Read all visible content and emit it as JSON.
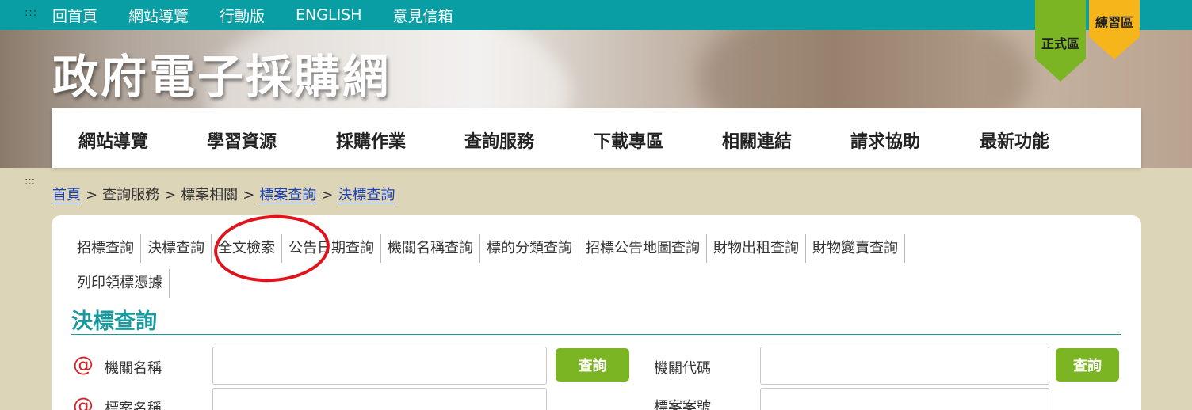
{
  "topbar": {
    "accesskey": ":::",
    "links": [
      "回首頁",
      "網站導覽",
      "行動版",
      "ENGLISH",
      "意見信箱"
    ]
  },
  "banner": {
    "title": "政府電子採購網"
  },
  "zones": {
    "formal": "正式區",
    "practice": "練習區"
  },
  "mainnav": [
    "網站導覽",
    "學習資源",
    "採購作業",
    "查詢服務",
    "下載專區",
    "相關連結",
    "請求協助",
    "最新功能"
  ],
  "breadcrumb": {
    "accesskey": ":::",
    "home": "首頁",
    "sep": ">",
    "query_service": "查詢服務",
    "tender_related": "標案相關",
    "tender_query": "標案查詢",
    "award_query": "決標查詢"
  },
  "subtabs": {
    "row1": [
      "招標查詢",
      "決標查詢",
      "全文檢索",
      "公告日期查詢",
      "機關名稱查詢",
      "標的分類查詢",
      "招標公告地圖查詢",
      "財物出租查詢",
      "財物變賣查詢"
    ],
    "row2": [
      "列印領標憑據"
    ]
  },
  "form": {
    "section_title": "決標查詢",
    "at_symbol": "@",
    "agency_name_label": "機關名稱",
    "agency_code_label": "機關代碼",
    "tender_name_label": "標案名稱",
    "tender_no_label": "標案案號",
    "query_button": "查詢"
  },
  "colors": {
    "topbar": "#089ea4",
    "accent_teal": "#1a9a9e",
    "button_green": "#7cb524",
    "practice_orange": "#f5b51b",
    "annotation_red": "#e0141c"
  }
}
